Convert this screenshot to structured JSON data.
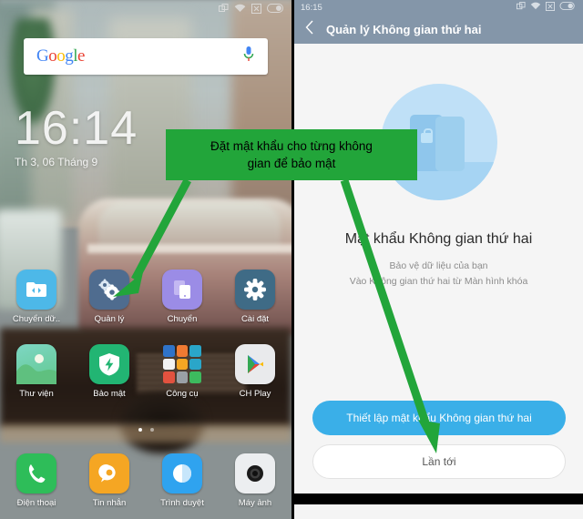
{
  "left_phone": {
    "statusbar": {
      "icons": [
        "multiwindow-icon",
        "wifi-icon",
        "sim-icon",
        "battery-icon"
      ]
    },
    "search": {
      "logo_g": "G",
      "logo_o1": "o",
      "logo_o2": "o",
      "logo_g2": "g",
      "logo_l": "l",
      "logo_e": "e",
      "mic": "microphone-icon"
    },
    "clock": {
      "time": "16:14",
      "date": "Th 3, 06 Tháng 9"
    },
    "apps_row1": [
      {
        "label": "Chuyển dữ..",
        "icon": "file-transfer-icon"
      },
      {
        "label": "Quản lý",
        "icon": "gears-icon"
      },
      {
        "label": "Chuyển",
        "icon": "switch-space-icon"
      },
      {
        "label": "Cài đặt",
        "icon": "gear-icon"
      }
    ],
    "apps_row2": [
      {
        "label": "Thư viện",
        "icon": "gallery-icon"
      },
      {
        "label": "Bảo mật",
        "icon": "shield-icon"
      },
      {
        "label": "Công cụ",
        "icon": "folder-icon"
      },
      {
        "label": "CH Play",
        "icon": "play-store-icon"
      }
    ],
    "dock": [
      {
        "label": "Điện thoại",
        "icon": "phone-icon"
      },
      {
        "label": "Tin nhắn",
        "icon": "message-icon"
      },
      {
        "label": "Trình duyệt",
        "icon": "browser-icon"
      },
      {
        "label": "Máy ảnh",
        "icon": "camera-icon"
      }
    ],
    "page_dots": 2
  },
  "right_phone": {
    "statusbar": {
      "time": "16:15",
      "icons": [
        "multiwindow-icon",
        "wifi-icon",
        "sim-icon",
        "battery-icon"
      ]
    },
    "header": {
      "back": "back-chevron-icon",
      "title": "Quản lý Không gian thứ hai"
    },
    "illustration": "second-space-lock-illustration",
    "heading": "Mật khẩu Không gian thứ hai",
    "subtitle_1": "Bảo vệ dữ liệu của bạn",
    "subtitle_2": "Vào Không gian thứ hai từ Màn hình khóa",
    "primary_button": "Thiết lập mật khẩu Không gian thứ hai",
    "secondary_button": "Lần tới"
  },
  "annotation": {
    "callout_line1": "Đặt mật khẩu cho từng không",
    "callout_line2": "gian để bảo mật",
    "color": "#22a53a",
    "arrows": [
      "arrow-to-quan-ly-app",
      "arrow-to-setup-password-button"
    ]
  },
  "colors": {
    "annotation_green": "#22a53a",
    "header_blue_gray": "#8496a9",
    "primary_blue": "#3aafe8"
  }
}
